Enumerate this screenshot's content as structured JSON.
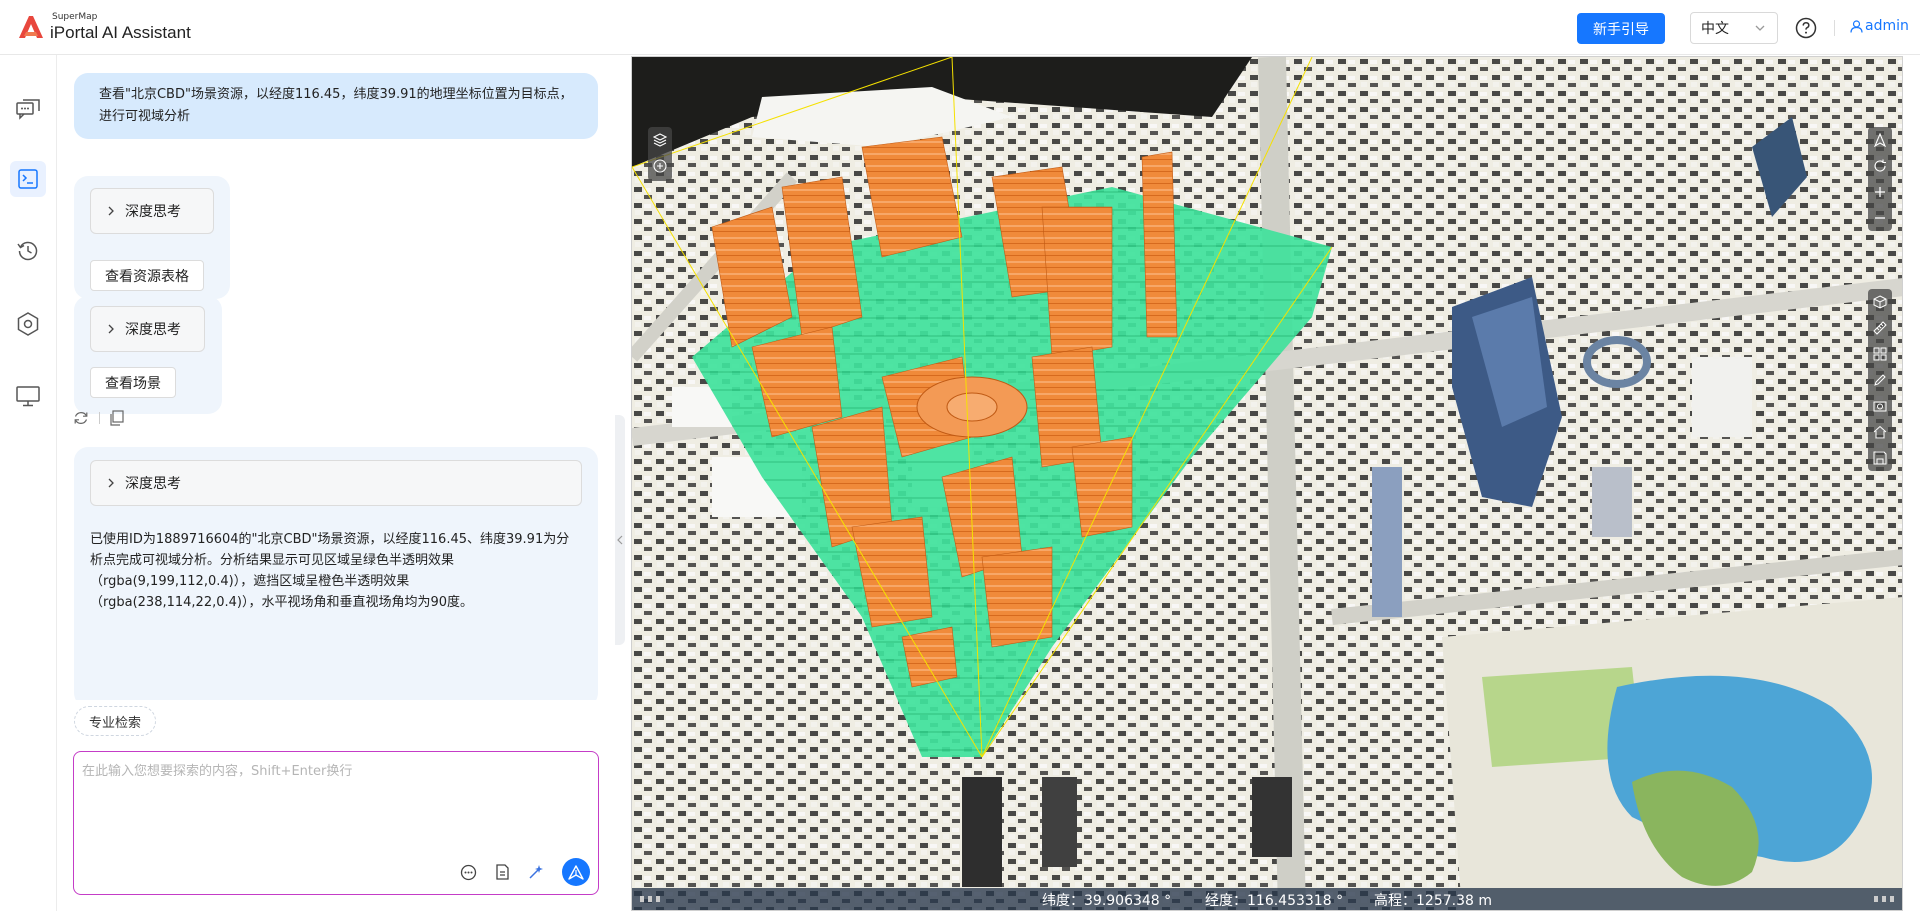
{
  "header": {
    "logo_sub": "SuperMap",
    "logo_main": "iPortal AI Assistant",
    "guide_label": "新手引导",
    "language": "中文",
    "user": "admin"
  },
  "rail": {
    "items": [
      "chat-icon",
      "terminal-icon",
      "history-icon",
      "settings-hex-icon",
      "monitor-icon"
    ],
    "active": 1
  },
  "chat": {
    "user_message": "查看\"北京CBD\"场景资源，以经度116.45，纬度39.91的地理坐标位置为目标点，进行可视域分析",
    "think_label": "深度思考",
    "btn_resource_table": "查看资源表格",
    "btn_scene": "查看场景",
    "answer": "已使用ID为1889716604的\"北京CBD\"场景资源，以经度116.45、纬度39.91为分析点完成可视域分析。分析结果显示可见区域呈绿色半透明效果（rgba(9,199,112,0.4)），遮挡区域呈橙色半透明效果（rgba(238,114,22,0.4)），水平视场角和垂直视场角均为90度。"
  },
  "composer": {
    "chip": "专业检索",
    "placeholder": "在此输入您想要探索的内容，Shift+Enter换行"
  },
  "scene": {
    "status": {
      "lat_label": "纬度：",
      "lat_value": "39.906348 °",
      "lon_label": "经度：",
      "lon_value": "116.453318 °",
      "alt_label": "高程：",
      "alt_value": "1257.38 m"
    },
    "visible_color": "#09c770",
    "blocked_color": "#ee7216",
    "left_tools": [
      "layers-icon",
      "add-circle-icon"
    ],
    "right_tools_top": [
      "compass-icon",
      "rotate-icon",
      "zoom-in-icon",
      "zoom-out-icon"
    ],
    "right_tools_mid": [
      "cube-icon",
      "ruler-icon",
      "grid-icon",
      "pen-icon",
      "screenshot-icon",
      "home-icon",
      "save-icon"
    ]
  }
}
